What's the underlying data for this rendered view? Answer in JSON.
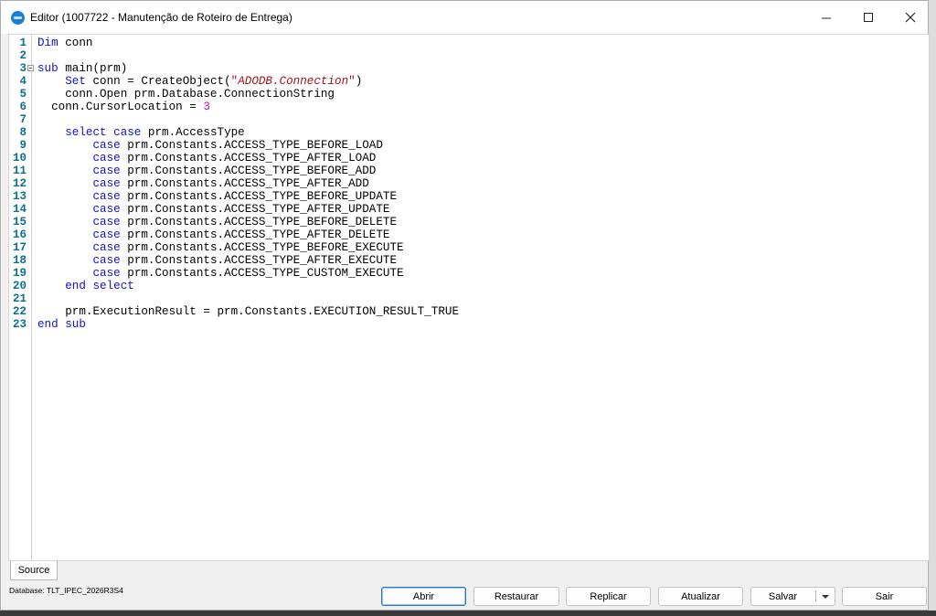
{
  "window": {
    "title": "Editor (1007722 - Manutenção de Roteiro de Entrega)",
    "minimize_glyph": "—",
    "maximize_glyph": "☐",
    "close_glyph": "✕"
  },
  "editor": {
    "lines": [
      {
        "n": "1",
        "parts": [
          {
            "t": "Dim",
            "c": "kw"
          },
          {
            "t": " conn"
          }
        ]
      },
      {
        "n": "2",
        "parts": []
      },
      {
        "n": "3",
        "fold": true,
        "parts": [
          {
            "t": "sub",
            "c": "kw"
          },
          {
            "t": " main(prm)"
          }
        ]
      },
      {
        "n": "4",
        "parts": [
          {
            "t": "    "
          },
          {
            "t": "Set",
            "c": "kw"
          },
          {
            "t": " conn = CreateObject("
          },
          {
            "t": "\"",
            "c": "ostr"
          },
          {
            "t": "ADODB.Connection",
            "c": "str"
          },
          {
            "t": "\"",
            "c": "ostr"
          },
          {
            "t": ")"
          }
        ]
      },
      {
        "n": "5",
        "parts": [
          {
            "t": "    conn.Open prm.Database.ConnectionString"
          }
        ]
      },
      {
        "n": "6",
        "parts": [
          {
            "t": "  conn.CursorLocation = "
          },
          {
            "t": "3",
            "c": "num"
          }
        ]
      },
      {
        "n": "7",
        "parts": []
      },
      {
        "n": "8",
        "parts": [
          {
            "t": "    "
          },
          {
            "t": "select case",
            "c": "kw"
          },
          {
            "t": " prm.AccessType"
          }
        ]
      },
      {
        "n": "9",
        "parts": [
          {
            "t": "        "
          },
          {
            "t": "case",
            "c": "kw"
          },
          {
            "t": " prm.Constants.ACCESS_TYPE_BEFORE_LOAD"
          }
        ]
      },
      {
        "n": "10",
        "parts": [
          {
            "t": "        "
          },
          {
            "t": "case",
            "c": "kw"
          },
          {
            "t": " prm.Constants.ACCESS_TYPE_AFTER_LOAD"
          }
        ]
      },
      {
        "n": "11",
        "parts": [
          {
            "t": "        "
          },
          {
            "t": "case",
            "c": "kw"
          },
          {
            "t": " prm.Constants.ACCESS_TYPE_BEFORE_ADD"
          }
        ]
      },
      {
        "n": "12",
        "parts": [
          {
            "t": "        "
          },
          {
            "t": "case",
            "c": "kw"
          },
          {
            "t": " prm.Constants.ACCESS_TYPE_AFTER_ADD"
          }
        ]
      },
      {
        "n": "13",
        "parts": [
          {
            "t": "        "
          },
          {
            "t": "case",
            "c": "kw"
          },
          {
            "t": " prm.Constants.ACCESS_TYPE_BEFORE_UPDATE"
          }
        ]
      },
      {
        "n": "14",
        "parts": [
          {
            "t": "        "
          },
          {
            "t": "case",
            "c": "kw"
          },
          {
            "t": " prm.Constants.ACCESS_TYPE_AFTER_UPDATE"
          }
        ]
      },
      {
        "n": "15",
        "parts": [
          {
            "t": "        "
          },
          {
            "t": "case",
            "c": "kw"
          },
          {
            "t": " prm.Constants.ACCESS_TYPE_BEFORE_DELETE"
          }
        ]
      },
      {
        "n": "16",
        "parts": [
          {
            "t": "        "
          },
          {
            "t": "case",
            "c": "kw"
          },
          {
            "t": " prm.Constants.ACCESS_TYPE_AFTER_DELETE"
          }
        ]
      },
      {
        "n": "17",
        "parts": [
          {
            "t": "        "
          },
          {
            "t": "case",
            "c": "kw"
          },
          {
            "t": " prm.Constants.ACCESS_TYPE_BEFORE_EXECUTE"
          }
        ]
      },
      {
        "n": "18",
        "parts": [
          {
            "t": "        "
          },
          {
            "t": "case",
            "c": "kw"
          },
          {
            "t": " prm.Constants.ACCESS_TYPE_AFTER_EXECUTE"
          }
        ]
      },
      {
        "n": "19",
        "parts": [
          {
            "t": "        "
          },
          {
            "t": "case",
            "c": "kw"
          },
          {
            "t": " prm.Constants.ACCESS_TYPE_CUSTOM_EXECUTE"
          }
        ]
      },
      {
        "n": "20",
        "parts": [
          {
            "t": "    "
          },
          {
            "t": "end select",
            "c": "kw"
          }
        ]
      },
      {
        "n": "21",
        "parts": []
      },
      {
        "n": "22",
        "parts": [
          {
            "t": "    prm.ExecutionResult = prm.Constants.EXECUTION_RESULT_TRUE"
          }
        ]
      },
      {
        "n": "23",
        "parts": [
          {
            "t": "end sub",
            "c": "kw"
          }
        ]
      }
    ]
  },
  "tabs": {
    "source": "Source"
  },
  "status": {
    "database": "Database: TLT_IPEC_2026R3S4"
  },
  "buttons": {
    "abrir": "Abrir",
    "restaurar": "Restaurar",
    "replicar": "Replicar",
    "atualizar": "Atualizar",
    "salvar": "Salvar",
    "sair": "Sair"
  },
  "colors": {
    "keyword": "#1010d8",
    "string": "#a31515",
    "number": "#d400d4",
    "line_number": "#0f6f8f"
  }
}
